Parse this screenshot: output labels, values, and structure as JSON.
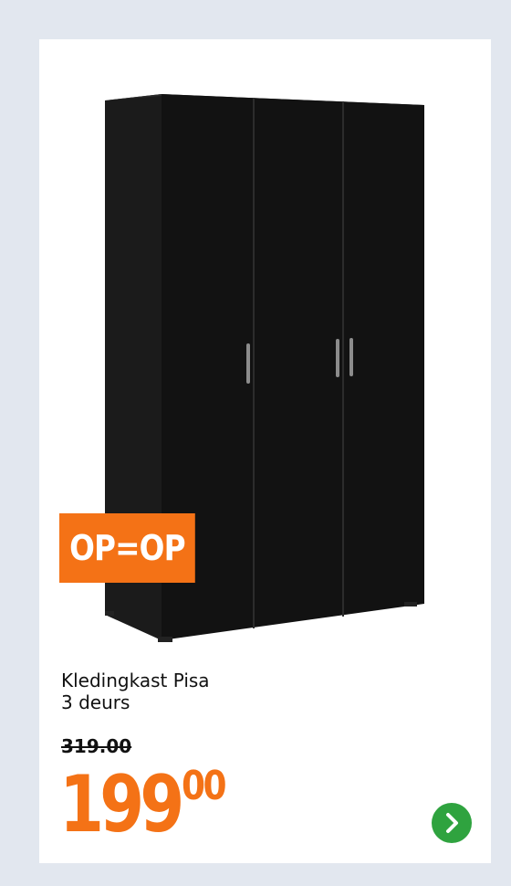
{
  "badge": {
    "label": "OP=OP",
    "color": "#f47216"
  },
  "product": {
    "title_line1": "Kledingkast Pisa",
    "title_line2": "3 deurs",
    "old_price": "319.00",
    "price_whole": "199",
    "price_decimals": "00",
    "price_color": "#f47216"
  },
  "icons": {
    "next": "chevron-right-icon",
    "next_color": "#2fa33f"
  }
}
